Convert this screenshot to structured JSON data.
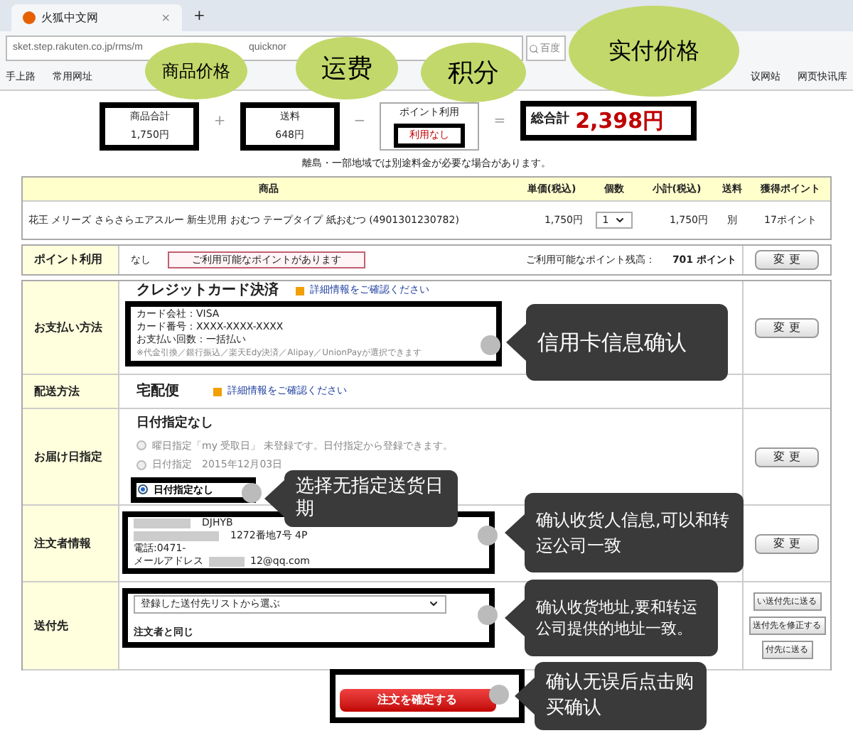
{
  "browser": {
    "tab_title": "火狐中文网",
    "tab_close": "×",
    "new_tab": "+",
    "url": "sket.step.rakuten.co.jp/rms/m",
    "url_tail": "quicknor",
    "search_placeholder": "百度",
    "bookmarks": [
      "手上路",
      "常用网址",
      "议网站",
      "网页快讯库"
    ]
  },
  "summary": {
    "items": [
      {
        "label": "商品合計",
        "value": "1,750円",
        "emphasized": false,
        "operator": "+"
      },
      {
        "label": "送料",
        "value": "648円",
        "emphasized": false,
        "operator": "−"
      },
      {
        "label": "ポイント利用",
        "value": "利用なし",
        "emphasized": true,
        "operator": "="
      }
    ],
    "total_label": "総合計",
    "total_value": "2,398円",
    "note": "離島・一部地域では別途料金が必要な場合があります。"
  },
  "product_table": {
    "columns": [
      "商品",
      "単価(税込)",
      "個数",
      "小計(税込)",
      "送料",
      "獲得ポイント"
    ],
    "rows": [
      {
        "name": "花王 メリーズ さらさらエアスルー 新生児用 おむつ テープタイプ  紙おむつ (4901301230782)",
        "unit_price": "1,750円",
        "quantity": "1",
        "subtotal": "1,750円",
        "shipping": "別",
        "points": "17ポイント"
      }
    ]
  },
  "points_row": {
    "label": "ポイント利用",
    "value": "なし",
    "notice": "ご利用可能なポイントがあります",
    "balance_label": "ご利用可能なポイント残高：",
    "balance": "701 ポイント",
    "button": "変 更"
  },
  "order_sections": [
    {
      "kind": "payment",
      "label": "お支払い方法",
      "title": "クレジットカード決済",
      "link": "詳細情報をご確認ください",
      "lines": [
        "カード会社：VISA",
        "カード番号：XXXX-XXXX-XXXX",
        "お支払い回数：一括払い"
      ],
      "note": "※代金引換／銀行振込／楽天Edy決済／Alipay／UnionPayが選択できます",
      "button": "変 更"
    },
    {
      "kind": "shipping",
      "label": "配送方法",
      "value": "宅配便",
      "link": "詳細情報をご確認ください"
    },
    {
      "kind": "delivery",
      "label": "お届け日指定",
      "current": "日付指定なし",
      "options": [
        {
          "label": "曜日指定「my 受取日」 未登録です。日付指定から登録できます。",
          "selected": false
        },
        {
          "label": "日付指定　2015年12月03日",
          "selected": false
        },
        {
          "label": "日付指定なし",
          "selected": true
        }
      ],
      "button": "変 更"
    },
    {
      "kind": "orderer",
      "label": "注文者情報",
      "lines": [
        "DJHYB",
        "1272番地7号 4P",
        "電話:0471-",
        "メールアドレス",
        "12@qq.com"
      ],
      "button": "変 更"
    },
    {
      "kind": "destination",
      "label": "送付先",
      "select": "登録した送付先リストから選ぶ",
      "value": "注文者と同じ",
      "buttons": [
        "い送付先に送る",
        "送付先を修正する",
        "付先に送る"
      ]
    }
  ],
  "confirm_button": "注文を確定する",
  "annotations": {
    "clouds": [
      "商品价格",
      "运费",
      "积分",
      "实付价格"
    ],
    "callouts": [
      "信用卡信息确认",
      "选择无指定送货日期",
      "确认收货人信息,可以和转运公司一致",
      "确认收货地址,要和转运公司提供的地址一致。",
      "确认无误后点击购买确认"
    ]
  }
}
